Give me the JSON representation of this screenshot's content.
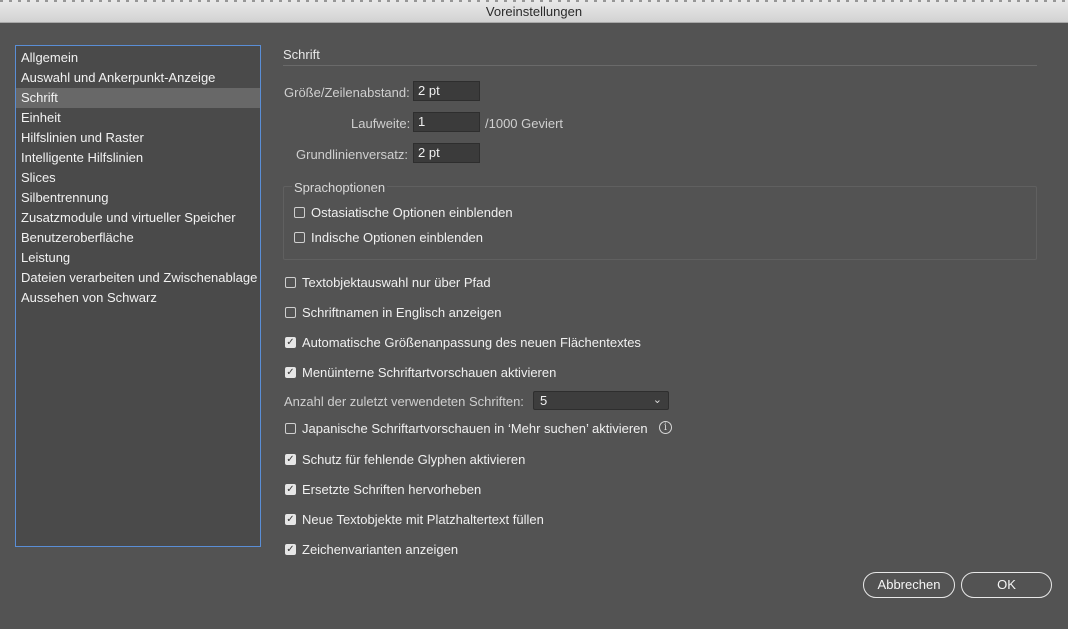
{
  "window": {
    "title": "Voreinstellungen"
  },
  "sidebar": {
    "items": [
      {
        "label": "Allgemein"
      },
      {
        "label": "Auswahl und Ankerpunkt-Anzeige"
      },
      {
        "label": "Schrift"
      },
      {
        "label": "Einheit"
      },
      {
        "label": "Hilfslinien und Raster"
      },
      {
        "label": "Intelligente Hilfslinien"
      },
      {
        "label": "Slices"
      },
      {
        "label": "Silbentrennung"
      },
      {
        "label": "Zusatzmodule und virtueller Speicher"
      },
      {
        "label": "Benutzeroberfläche"
      },
      {
        "label": "Leistung"
      },
      {
        "label": "Dateien verarbeiten und Zwischenablage"
      },
      {
        "label": "Aussehen von Schwarz"
      }
    ],
    "selected": "Schrift"
  },
  "section": {
    "title": "Schrift"
  },
  "fields": {
    "size_label": "Größe/Zeilenabstand:",
    "size_value": "2 pt",
    "tracking_label": "Laufweite:",
    "tracking_value": "1",
    "tracking_unit": "/1000 Geviert",
    "baseline_label": "Grundlinienversatz:",
    "baseline_value": "2 pt"
  },
  "language_options": {
    "title": "Sprachoptionen",
    "east_asian": {
      "label": "Ostasiatische Optionen einblenden",
      "checked": false
    },
    "indic": {
      "label": "Indische Optionen einblenden",
      "checked": false
    }
  },
  "options": {
    "text_object_path": {
      "label": "Textobjektauswahl nur über Pfad",
      "checked": false
    },
    "font_names_english": {
      "label": "Schriftnamen in Englisch anzeigen",
      "checked": false
    },
    "auto_size": {
      "label": "Automatische Größenanpassung des neuen Flächentextes",
      "checked": true
    },
    "menu_preview": {
      "label": "Menüinterne Schriftartvorschauen aktivieren",
      "checked": true
    },
    "recent_fonts_label": "Anzahl der zuletzt verwendeten Schriften:",
    "recent_fonts_value": "5",
    "japanese_preview": {
      "label": "Japanische Schriftartvorschauen in ‘Mehr suchen’ aktivieren",
      "checked": false
    },
    "missing_glyph": {
      "label": "Schutz für fehlende Glyphen aktivieren",
      "checked": true
    },
    "highlight_substituted": {
      "label": "Ersetzte Schriften hervorheben",
      "checked": true
    },
    "placeholder_text": {
      "label": "Neue Textobjekte mit Platzhaltertext füllen",
      "checked": true
    },
    "glyph_alternates": {
      "label": "Zeichenvarianten anzeigen",
      "checked": true
    }
  },
  "buttons": {
    "cancel": "Abbrechen",
    "ok": "OK"
  },
  "icons": {
    "info": "info-icon",
    "chevron": "chevron-down-icon",
    "check": "checkmark-icon"
  }
}
